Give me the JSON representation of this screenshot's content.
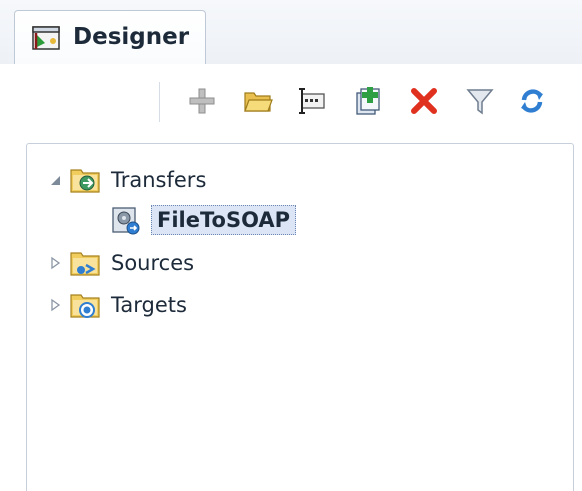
{
  "tab": {
    "label": "Designer",
    "icon": "designer-icon"
  },
  "toolbar": {
    "buttons": [
      {
        "name": "add-icon",
        "tooltip": ""
      },
      {
        "name": "open-folder-icon",
        "tooltip": ""
      },
      {
        "name": "edit-icon",
        "tooltip": ""
      },
      {
        "name": "new-item-icon",
        "tooltip": ""
      },
      {
        "name": "delete-icon",
        "tooltip": ""
      },
      {
        "name": "filter-icon",
        "tooltip": ""
      },
      {
        "name": "refresh-icon",
        "tooltip": ""
      }
    ]
  },
  "tree": {
    "items": [
      {
        "label": "Transfers",
        "expanded": true,
        "level": 0,
        "icon": "transfers-folder-icon"
      },
      {
        "label": "FileToSOAP",
        "selected": true,
        "level": 1,
        "icon": "transfer-item-icon"
      },
      {
        "label": "Sources",
        "expanded": false,
        "level": 0,
        "icon": "sources-folder-icon"
      },
      {
        "label": "Targets",
        "expanded": false,
        "level": 0,
        "icon": "targets-folder-icon"
      }
    ]
  },
  "colors": {
    "selection_bg": "#dbe5f5",
    "delete_red": "#e0301e",
    "folder_yellow": "#f1cd5e"
  }
}
